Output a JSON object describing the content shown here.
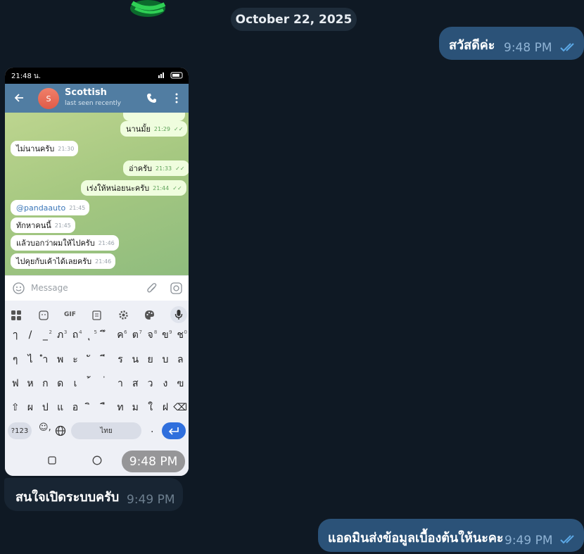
{
  "date_separator": "October 22, 2025",
  "messages": [
    {
      "text": "สวัสดีค่ะ",
      "time": "9:48 PM"
    },
    {
      "time": "9:48 PM"
    },
    {
      "text": "สนใจเปิดระบบครับ",
      "time": "9:49 PM"
    },
    {
      "text": "แอดมินส่งข้อมูลเบื้องต้นให้นะคะ",
      "time": "9:49 PM"
    }
  ],
  "phone": {
    "status_time": "21:48 น.",
    "contact_name": "Scottish",
    "contact_status": "last seen recently",
    "avatar_letter": "S",
    "chat": [
      {
        "text": "นานมั้ย",
        "time": "21:29"
      },
      {
        "text": "ไม่นานครับ",
        "time": "21:30"
      },
      {
        "text": "อ่าครับ",
        "time": "21:33"
      },
      {
        "text": "เร่งให้หน่อยนะครับ",
        "time": "21:44"
      },
      {
        "text": "@pandaauto",
        "time": "21:45"
      },
      {
        "text": "ทักหาคนนี้",
        "time": "21:45"
      },
      {
        "text": "แล้วบอกว่าผมให้ไปครับ",
        "time": "21:46"
      },
      {
        "text": "ไปคุยกับเค้าได้เลยครับ",
        "time": "21:46"
      }
    ],
    "input_placeholder": "Message",
    "gif_label": "GIF",
    "keyboard": {
      "row1": [
        "ๅ",
        "/",
        "_",
        "ภ",
        "ถ",
        "ุ",
        "ึ",
        "ค",
        "ต",
        "จ",
        "ข",
        "ช"
      ],
      "row1_hints": [
        "",
        "",
        "2",
        "3",
        "4",
        "5",
        "",
        "6",
        "7",
        "8",
        "9",
        "0"
      ],
      "row2": [
        "ๆ",
        "ไ",
        "ำ",
        "พ",
        "ะ",
        "ั",
        "ี",
        "ร",
        "น",
        "ย",
        "บ",
        "ล"
      ],
      "row3": [
        "ฟ",
        "ห",
        "ก",
        "ด",
        "เ",
        "้",
        "่",
        "า",
        "ส",
        "ว",
        "ง",
        "ฃ"
      ],
      "row4": [
        "ผ",
        "ป",
        "แ",
        "อ",
        "ิ",
        "ื",
        "ท",
        "ม",
        "ใ",
        "ฝ"
      ],
      "symbols_key": "?123",
      "emoji_key": ",",
      "space_label": "ไทย",
      "period_key": "."
    }
  },
  "colors": {
    "background": "#0f1924",
    "outgoing_bubble": "#2b5278",
    "incoming_bubble": "#182533",
    "phone_header": "#517da2",
    "read_ticks": "#5ba8e6"
  }
}
